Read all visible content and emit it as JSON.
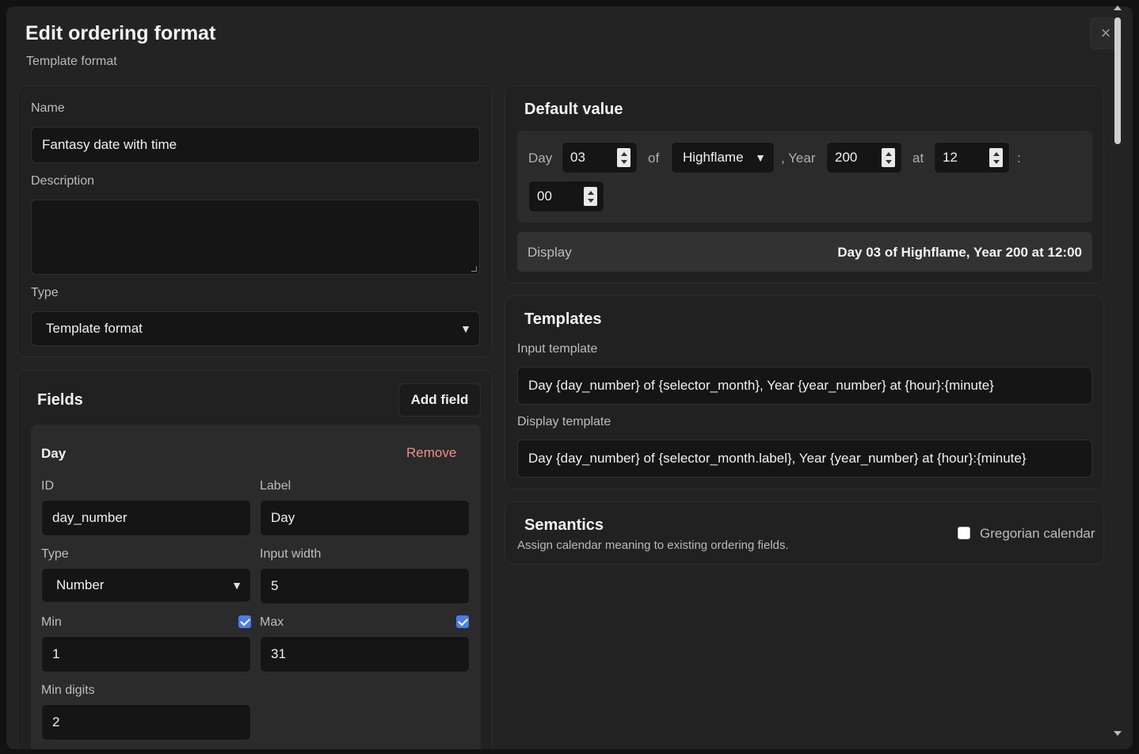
{
  "modal": {
    "title": "Edit ordering format",
    "subtitle": "Template format",
    "close_icon": "×"
  },
  "details": {
    "name_label": "Name",
    "name_value": "Fantasy date with time",
    "description_label": "Description",
    "description_value": "",
    "type_label": "Type",
    "type_value": "Template format"
  },
  "fields": {
    "title": "Fields",
    "add_button": "Add field",
    "day_field": {
      "title": "Day",
      "remove_button": "Remove",
      "id_label": "ID",
      "id_value": "day_number",
      "label_label": "Label",
      "label_value": "Day",
      "type_label": "Type",
      "type_value": "Number",
      "input_width_label": "Input width",
      "input_width_value": "5",
      "min_label": "Min",
      "min_checked": true,
      "min_value": "1",
      "max_label": "Max",
      "max_checked": true,
      "max_value": "31",
      "min_digits_label": "Min digits",
      "min_digits_value": "2"
    }
  },
  "default_value": {
    "title": "Default value",
    "day_text": "Day",
    "day_value": "03",
    "of_text": "of",
    "month_value": "Highflame",
    "year_text": ", Year",
    "year_value": "200",
    "at_text": "at",
    "hour_value": "12",
    "colon_text": ":",
    "minute_value": "00",
    "display_label": "Display",
    "display_value": "Day 03 of Highflame, Year 200 at 12:00"
  },
  "templates": {
    "title": "Templates",
    "input_label": "Input template",
    "input_value": "Day {day_number} of {selector_month}, Year {year_number} at {hour}:{minute}",
    "display_label": "Display template",
    "display_value": "Day {day_number} of {selector_month.label}, Year {year_number} at {hour}:{minute}"
  },
  "semantics": {
    "title": "Semantics",
    "description": "Assign calendar meaning to existing ordering fields.",
    "gregorian_label": "Gregorian calendar",
    "gregorian_checked": false
  },
  "colors": {
    "accent": "#4b7bec",
    "danger": "#ef8f84",
    "background": "#232323"
  }
}
